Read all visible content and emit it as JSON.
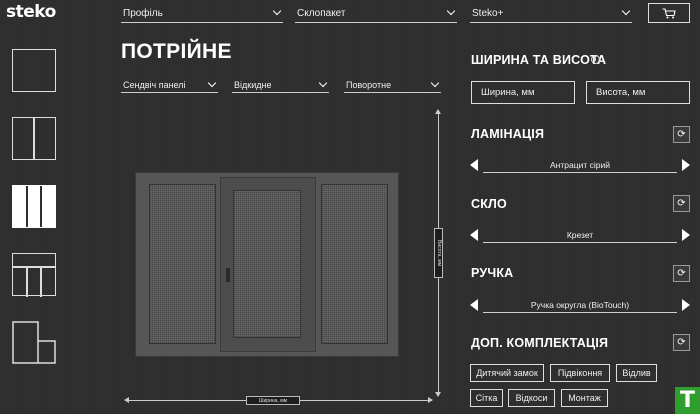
{
  "logo": {
    "text": "steko"
  },
  "header": {
    "profile_select": "Профіль",
    "glass_pack_select": "Склопакет",
    "steko_select": "Steko+",
    "cart_icon": "cart-icon"
  },
  "page": {
    "title": "ПОТРІЙНЕ"
  },
  "sub_selects": [
    {
      "label": "Сендвіч панелі"
    },
    {
      "label": "Відкидне"
    },
    {
      "label": "Поворотне"
    }
  ],
  "dimensions": {
    "width_label": "Ширина, мм",
    "height_label": "Висота, мм"
  },
  "panel": {
    "size_title": "ШИРИНА ТА ВИСОТА",
    "width_placeholder": "Ширина, мм",
    "height_placeholder": "Висота, мм",
    "lamination_title": "ЛАМІНАЦІЯ",
    "lamination_value": "Антрацит сірий",
    "glass_title": "СКЛО",
    "glass_value": "Крезет",
    "handle_title": "РУЧКА",
    "handle_value": "Ручка округла (BioTouch)",
    "extras_title": "ДОП. КОМПЛЕКТАЦІЯ",
    "extras": [
      "Дитячий замок",
      "Підвіконня",
      "Відлив",
      "Сітка",
      "Відкоси",
      "Монтаж"
    ]
  },
  "badge": {
    "text": "T"
  },
  "colors": {
    "background": "#2e2e2e",
    "badge": "#2f9e2f"
  }
}
